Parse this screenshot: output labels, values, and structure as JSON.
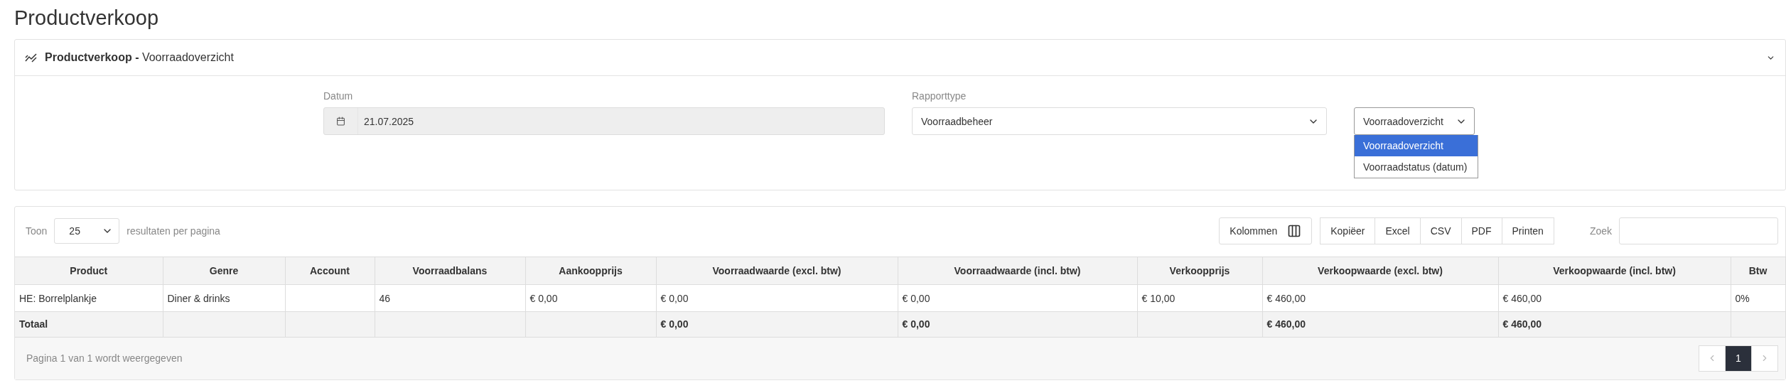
{
  "page_title": "Productverkoop",
  "panel": {
    "title_bold": "Productverkoop -",
    "title_rest": "Voorraadoverzicht",
    "expanded": true
  },
  "filters": {
    "date": {
      "label": "Datum",
      "value": "21.07.2025",
      "disabled": true
    },
    "report_type": {
      "label": "Rapporttype",
      "value": "Voorraadbeheer"
    },
    "view": {
      "value": "Voorraadoverzicht",
      "open": true,
      "options": [
        {
          "label": "Voorraadoverzicht",
          "selected": true
        },
        {
          "label": "Voorraadstatus (datum)",
          "selected": false
        }
      ]
    }
  },
  "table_controls": {
    "show_label": "Toon",
    "page_size": "25",
    "per_page_label": "resultaten per pagina",
    "columns_button": "Kolommen",
    "export_buttons": [
      "Kopiëer",
      "Excel",
      "CSV",
      "PDF",
      "Printen"
    ],
    "search_label": "Zoek"
  },
  "table": {
    "columns": [
      "Product",
      "Genre",
      "Account",
      "Voorraadbalans",
      "Aankoopprijs",
      "Voorraadwaarde (excl. btw)",
      "Voorraadwaarde (incl. btw)",
      "Verkoopprijs",
      "Verkoopwaarde (excl. btw)",
      "Verkoopwaarde (incl. btw)",
      "Btw"
    ],
    "rows": [
      [
        "HE: Borrelplankje",
        "Diner & drinks",
        null,
        "46",
        "€ 0,00",
        "€ 0,00",
        "€ 0,00",
        "€ 10,00",
        "€ 460,00",
        "€ 460,00",
        "0%"
      ]
    ],
    "total": {
      "label": "Totaal",
      "stock_value_excl": "€ 0,00",
      "stock_value_incl": "€ 0,00",
      "sales_value_excl": "€ 460,00",
      "sales_value_incl": "€ 460,00"
    }
  },
  "footer": {
    "info": "Pagina 1 van 1 wordt weergegeven",
    "pages": [
      {
        "label": "1",
        "selected": true
      }
    ],
    "prev_disabled": true,
    "next_disabled": true
  }
}
